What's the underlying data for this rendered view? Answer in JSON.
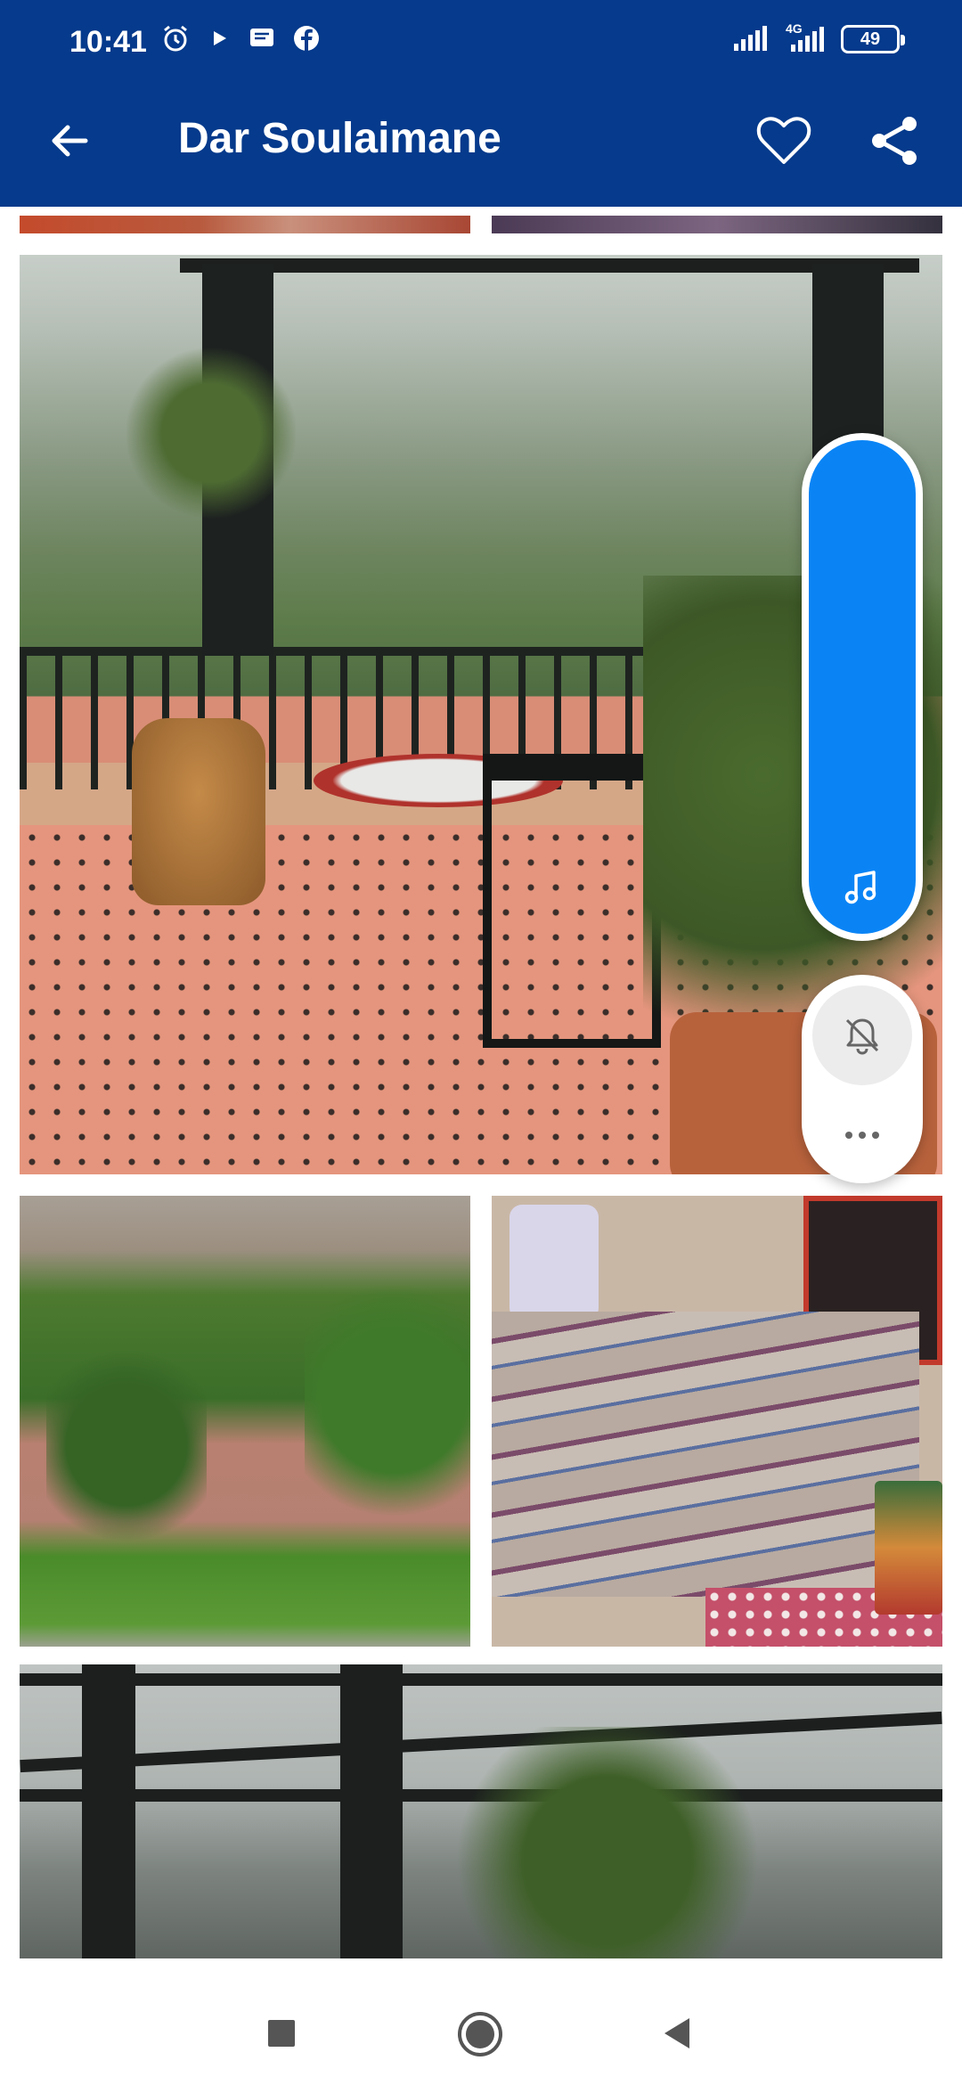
{
  "status_bar": {
    "time": "10:41",
    "battery_level": "49",
    "network_label": "4G",
    "icons": [
      "alarm-icon",
      "play-icon",
      "message-icon",
      "facebook-icon",
      "signal-icon",
      "signal-4g-icon",
      "battery-icon"
    ]
  },
  "app_bar": {
    "title": "Dar Soulaimane",
    "back_icon": "arrow-left-icon",
    "favorite_icon": "heart-outline-icon",
    "share_icon": "share-icon"
  },
  "gallery": {
    "photos": [
      "terrace-with-rainbow",
      "garden-wall",
      "bedroom",
      "pergola"
    ]
  },
  "floating_widget": {
    "music_icon": "music-note-icon",
    "mute_icon": "bell-off-icon",
    "more_icon": "more-horizontal-icon"
  },
  "nav_bar": {
    "icons": [
      "recents-square-icon",
      "home-circle-icon",
      "back-triangle-icon"
    ]
  },
  "colors": {
    "header_bg": "#053a8c",
    "music_accent": "#0a84f5"
  }
}
